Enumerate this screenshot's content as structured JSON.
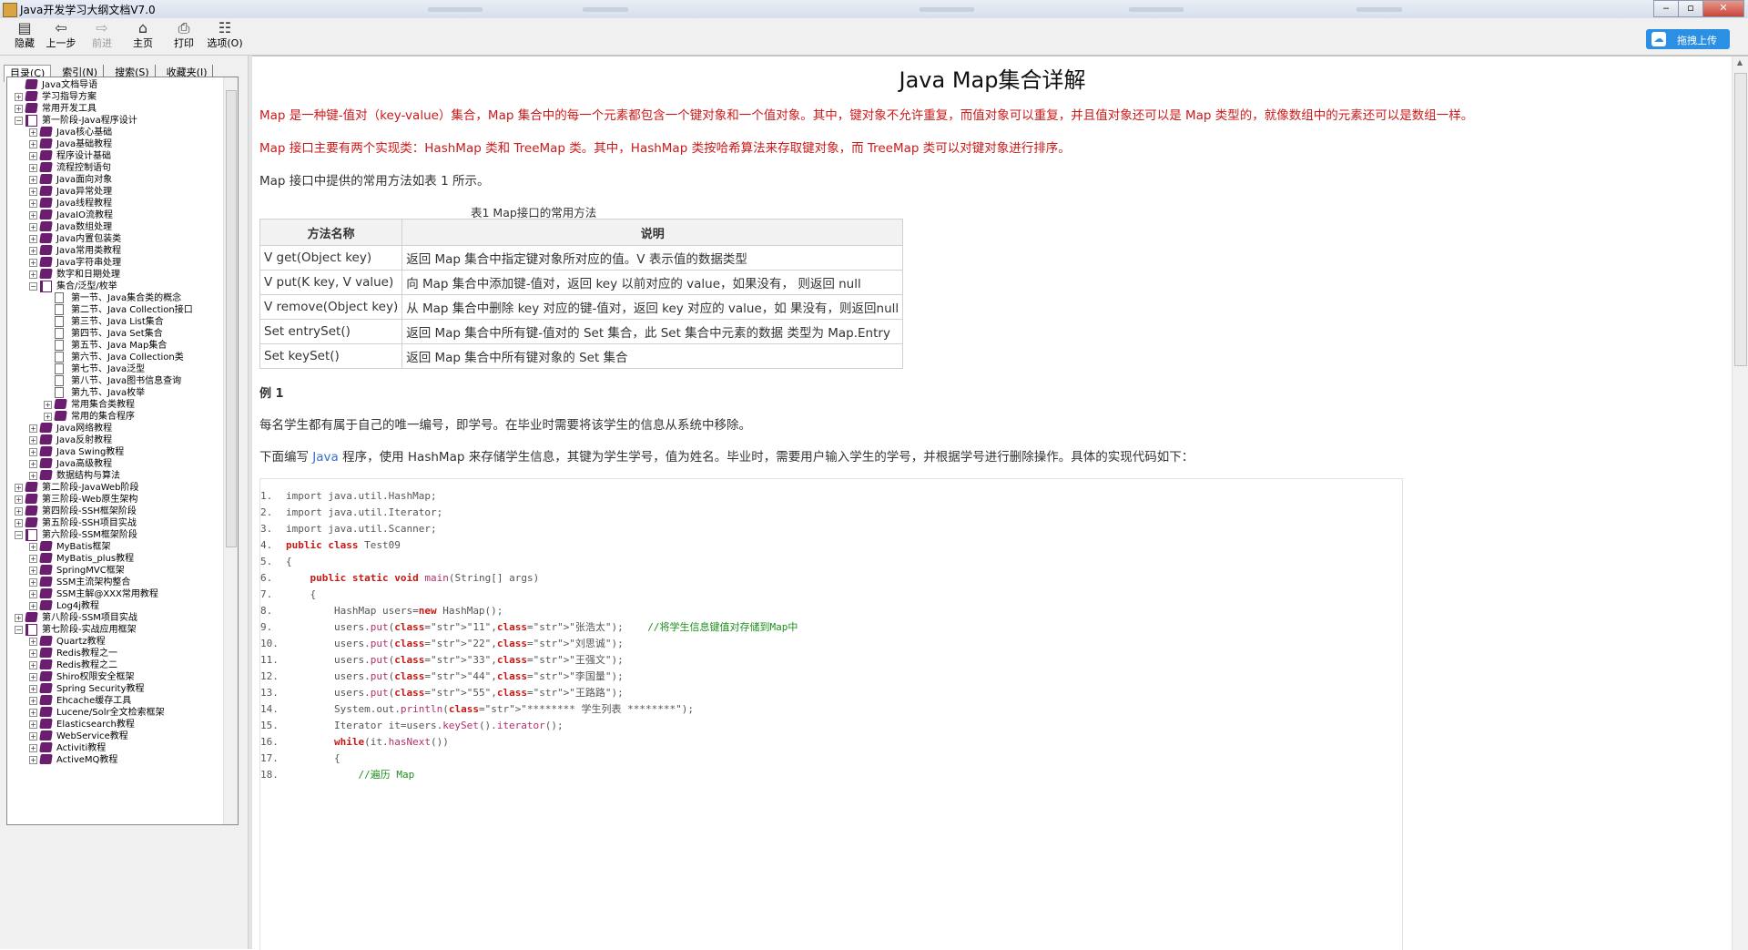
{
  "window": {
    "title": "Java开发学习大纲文档V7.0"
  },
  "toolbar": {
    "hide": "隐藏",
    "back": "上一步",
    "forward": "前进",
    "home": "主页",
    "print": "打印",
    "options": "选项(O)",
    "upload": "拖拽上传"
  },
  "tabs": {
    "contents": "目录(C)",
    "index": "索引(N)",
    "search": "搜索(S)",
    "favorites": "收藏夹(I)"
  },
  "tree": [
    {
      "depth": 0,
      "exp": "",
      "icon": "book",
      "label": "Java文档导语"
    },
    {
      "depth": 0,
      "exp": "+",
      "icon": "book",
      "label": "学习指导方案"
    },
    {
      "depth": 0,
      "exp": "+",
      "icon": "book",
      "label": "常用开发工具"
    },
    {
      "depth": 0,
      "exp": "-",
      "icon": "open",
      "label": "第一阶段-Java程序设计"
    },
    {
      "depth": 1,
      "exp": "+",
      "icon": "book",
      "label": "Java核心基础"
    },
    {
      "depth": 1,
      "exp": "+",
      "icon": "book",
      "label": "Java基础教程"
    },
    {
      "depth": 1,
      "exp": "+",
      "icon": "book",
      "label": "程序设计基础"
    },
    {
      "depth": 1,
      "exp": "+",
      "icon": "book",
      "label": "流程控制语句"
    },
    {
      "depth": 1,
      "exp": "+",
      "icon": "book",
      "label": "Java面向对象"
    },
    {
      "depth": 1,
      "exp": "+",
      "icon": "book",
      "label": "Java异常处理"
    },
    {
      "depth": 1,
      "exp": "+",
      "icon": "book",
      "label": "Java线程教程"
    },
    {
      "depth": 1,
      "exp": "+",
      "icon": "book",
      "label": "JavaIO流教程"
    },
    {
      "depth": 1,
      "exp": "+",
      "icon": "book",
      "label": "Java数组处理"
    },
    {
      "depth": 1,
      "exp": "+",
      "icon": "book",
      "label": "Java内置包装类"
    },
    {
      "depth": 1,
      "exp": "+",
      "icon": "book",
      "label": "Java常用类教程"
    },
    {
      "depth": 1,
      "exp": "+",
      "icon": "book",
      "label": "Java字符串处理"
    },
    {
      "depth": 1,
      "exp": "+",
      "icon": "book",
      "label": "数字和日期处理"
    },
    {
      "depth": 1,
      "exp": "-",
      "icon": "open",
      "label": "集合/泛型/枚举"
    },
    {
      "depth": 2,
      "exp": "",
      "icon": "page",
      "label": "第一节、Java集合类的概念"
    },
    {
      "depth": 2,
      "exp": "",
      "icon": "page",
      "label": "第二节、Java Collection接口"
    },
    {
      "depth": 2,
      "exp": "",
      "icon": "page",
      "label": "第三节、Java List集合"
    },
    {
      "depth": 2,
      "exp": "",
      "icon": "page",
      "label": "第四节、Java Set集合"
    },
    {
      "depth": 2,
      "exp": "",
      "icon": "page",
      "label": "第五节、Java Map集合"
    },
    {
      "depth": 2,
      "exp": "",
      "icon": "page",
      "label": "第六节、Java Collection类"
    },
    {
      "depth": 2,
      "exp": "",
      "icon": "page",
      "label": "第七节、Java泛型"
    },
    {
      "depth": 2,
      "exp": "",
      "icon": "page",
      "label": "第八节、Java图书信息查询"
    },
    {
      "depth": 2,
      "exp": "",
      "icon": "page",
      "label": "第九节、Java枚举"
    },
    {
      "depth": 2,
      "exp": "+",
      "icon": "book",
      "label": "常用集合类教程"
    },
    {
      "depth": 2,
      "exp": "+",
      "icon": "book",
      "label": "常用的集合程序"
    },
    {
      "depth": 1,
      "exp": "+",
      "icon": "book",
      "label": "Java网络教程"
    },
    {
      "depth": 1,
      "exp": "+",
      "icon": "book",
      "label": "Java反射教程"
    },
    {
      "depth": 1,
      "exp": "+",
      "icon": "book",
      "label": "Java Swing教程"
    },
    {
      "depth": 1,
      "exp": "+",
      "icon": "book",
      "label": "Java高级教程"
    },
    {
      "depth": 1,
      "exp": "+",
      "icon": "book",
      "label": "数据结构与算法"
    },
    {
      "depth": 0,
      "exp": "+",
      "icon": "book",
      "label": "第二阶段-JavaWeb阶段"
    },
    {
      "depth": 0,
      "exp": "+",
      "icon": "book",
      "label": "第三阶段-Web原生架构"
    },
    {
      "depth": 0,
      "exp": "+",
      "icon": "book",
      "label": "第四阶段-SSH框架阶段"
    },
    {
      "depth": 0,
      "exp": "+",
      "icon": "book",
      "label": "第五阶段-SSH项目实战"
    },
    {
      "depth": 0,
      "exp": "-",
      "icon": "open",
      "label": "第六阶段-SSM框架阶段"
    },
    {
      "depth": 1,
      "exp": "+",
      "icon": "book",
      "label": "MyBatis框架"
    },
    {
      "depth": 1,
      "exp": "+",
      "icon": "book",
      "label": "MyBatis_plus教程"
    },
    {
      "depth": 1,
      "exp": "+",
      "icon": "book",
      "label": "SpringMVC框架"
    },
    {
      "depth": 1,
      "exp": "+",
      "icon": "book",
      "label": "SSM主流架构整合"
    },
    {
      "depth": 1,
      "exp": "+",
      "icon": "book",
      "label": "SSM主解@XXX常用教程"
    },
    {
      "depth": 1,
      "exp": "+",
      "icon": "book",
      "label": "Log4j教程"
    },
    {
      "depth": 0,
      "exp": "+",
      "icon": "book",
      "label": "第八阶段-SSM项目实战"
    },
    {
      "depth": 0,
      "exp": "-",
      "icon": "open",
      "label": "第七阶段-实战应用框架"
    },
    {
      "depth": 1,
      "exp": "+",
      "icon": "book",
      "label": "Quartz教程"
    },
    {
      "depth": 1,
      "exp": "+",
      "icon": "book",
      "label": "Redis教程之一"
    },
    {
      "depth": 1,
      "exp": "+",
      "icon": "book",
      "label": "Redis教程之二"
    },
    {
      "depth": 1,
      "exp": "+",
      "icon": "book",
      "label": "Shiro权限安全框架"
    },
    {
      "depth": 1,
      "exp": "+",
      "icon": "book",
      "label": "Spring Security教程"
    },
    {
      "depth": 1,
      "exp": "+",
      "icon": "book",
      "label": "Ehcache缓存工具"
    },
    {
      "depth": 1,
      "exp": "+",
      "icon": "book",
      "label": "Lucene/Solr全文检索框架"
    },
    {
      "depth": 1,
      "exp": "+",
      "icon": "book",
      "label": "Elasticsearch教程"
    },
    {
      "depth": 1,
      "exp": "+",
      "icon": "book",
      "label": "WebService教程"
    },
    {
      "depth": 1,
      "exp": "+",
      "icon": "book",
      "label": "Activiti教程"
    },
    {
      "depth": 1,
      "exp": "+",
      "icon": "book",
      "label": "ActiveMQ教程"
    }
  ],
  "article": {
    "title": "Java Map集合详解",
    "p1": "Map 是一种键-值对（key-value）集合，Map 集合中的每一个元素都包含一个键对象和一个值对象。其中，键对象不允许重复，而值对象可以重复，并且值对象还可以是 Map 类型的，就像数组中的元素还可以是数组一样。",
    "p2": "Map 接口主要有两个实现类：HashMap 类和 TreeMap 类。其中，HashMap 类按哈希算法来存取键对象，而 TreeMap 类可以对键对象进行排序。",
    "p3": "Map 接口中提供的常用方法如表 1 所示。",
    "table_caption": "表1 Map接口的常用方法",
    "table_headers": [
      "方法名称",
      "说明"
    ],
    "table_rows": [
      [
        "V get(Object key)",
        "返回 Map 集合中指定键对象所对应的值。V 表示值的数据类型"
      ],
      [
        "V put(K key, V value)",
        "向 Map 集合中添加键-值对，返回 key 以前对应的 value，如果没有， 则返回 null"
      ],
      [
        "V remove(Object key)",
        "从 Map 集合中删除 key 对应的键-值对，返回 key 对应的 value，如 果没有，则返回null"
      ],
      [
        "Set entrySet()",
        "返回 Map 集合中所有键-值对的 Set 集合，此 Set 集合中元素的数据 类型为 Map.Entry"
      ],
      [
        "Set keySet()",
        "返回 Map 集合中所有键对象的 Set 集合"
      ]
    ],
    "example_label": "例 1",
    "p4": "每名学生都有属于自己的唯一编号，即学号。在毕业时需要将该学生的信息从系统中移除。",
    "p5_pre": "下面编写 ",
    "p5_link": "Java",
    "p5_post": " 程序，使用 HashMap 来存储学生信息，其键为学生学号，值为姓名。毕业时，需要用户输入学生的学号，并根据学号进行删除操作。具体的实现代码如下："
  },
  "code": [
    {
      "n": "1.",
      "t": "import java.util.HashMap;"
    },
    {
      "n": "2.",
      "t": "import java.util.Iterator;"
    },
    {
      "n": "3.",
      "t": "import java.util.Scanner;"
    },
    {
      "n": "4.",
      "t": "public class Test09"
    },
    {
      "n": "5.",
      "t": "{"
    },
    {
      "n": "6.",
      "t": "    public static void main(String[] args)"
    },
    {
      "n": "7.",
      "t": "    {"
    },
    {
      "n": "8.",
      "t": "        HashMap users=new HashMap();"
    },
    {
      "n": "9.",
      "t": "        users.put(\"11\",\"张浩太\");    //将学生信息键值对存储到Map中"
    },
    {
      "n": "10.",
      "t": "        users.put(\"22\",\"刘思诚\");"
    },
    {
      "n": "11.",
      "t": "        users.put(\"33\",\"王强文\");"
    },
    {
      "n": "12.",
      "t": "        users.put(\"44\",\"李国量\");"
    },
    {
      "n": "13.",
      "t": "        users.put(\"55\",\"王路路\");"
    },
    {
      "n": "14.",
      "t": "        System.out.println(\"******** 学生列表 ********\");"
    },
    {
      "n": "15.",
      "t": "        Iterator it=users.keySet().iterator();"
    },
    {
      "n": "16.",
      "t": "        while(it.hasNext())"
    },
    {
      "n": "17.",
      "t": "        {"
    },
    {
      "n": "18.",
      "t": "            //遍历 Map"
    }
  ],
  "colors": {
    "accent_red": "#cc1a1a",
    "link_blue": "#3a6fc9",
    "upload_blue": "#2b8fe3",
    "tree_book": "#6b1d6f"
  }
}
